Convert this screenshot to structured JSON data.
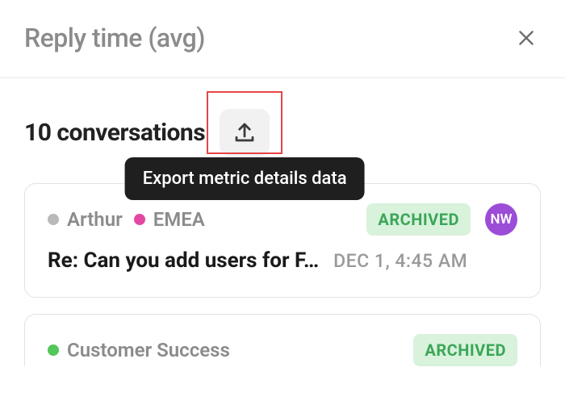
{
  "header": {
    "title": "Reply time (avg)"
  },
  "section": {
    "title": "10 conversations",
    "export_tooltip": "Export metric details data"
  },
  "colors": {
    "tag_grey": "#b9b9b9",
    "tag_pink": "#e248a2",
    "tag_green": "#53c75a",
    "badge_bg": "#d8f2dc",
    "badge_fg": "#3ba657",
    "avatar_bg": "#9b4dd8"
  },
  "cards": [
    {
      "tags": [
        {
          "label": "Arthur",
          "color_key": "tag_grey"
        },
        {
          "label": "EMEA",
          "color_key": "tag_pink"
        }
      ],
      "status": "ARCHIVED",
      "avatar": "NW",
      "subject": "Re: Can you add users for F…",
      "timestamp": "DEC 1, 4:45 AM"
    },
    {
      "tags": [
        {
          "label": "Customer Success",
          "color_key": "tag_green"
        }
      ],
      "status": "ARCHIVED"
    }
  ]
}
